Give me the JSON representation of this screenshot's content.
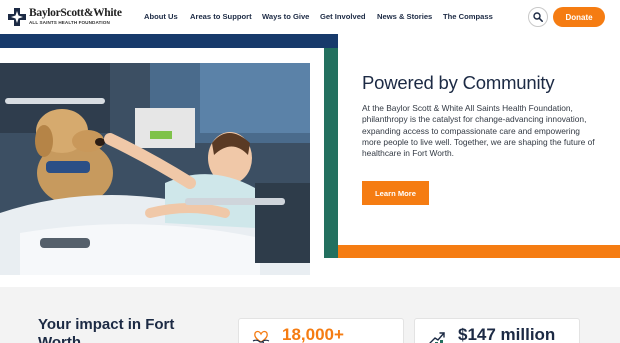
{
  "header": {
    "logo": {
      "name": "BaylorScott&White",
      "subtitle": "ALL SAINTS HEALTH FOUNDATION",
      "icon": "cross-logo-icon"
    },
    "nav": [
      {
        "label": "About Us"
      },
      {
        "label": "Areas to Support"
      },
      {
        "label": "Ways to Give"
      },
      {
        "label": "Get Involved"
      },
      {
        "label": "News & Stories"
      },
      {
        "label": "The Compass"
      }
    ],
    "search_icon": "search-icon",
    "donate_label": "Donate"
  },
  "hero": {
    "title": "Powered by Community",
    "body": "At the Baylor Scott & White All Saints Health Foundation, philanthropy is the catalyst for change-advancing innovation, expanding access to compassionate care and empowering more people to live well. Together, we are shaping the future of healthcare in Fort Worth.",
    "cta_label": "Learn More",
    "photo_subject": "patient in hospital bed petting a therapy dog"
  },
  "impact": {
    "title": "Your impact in Fort Worth",
    "stats": [
      {
        "value": "18,000+",
        "icon": "heart-hands-icon"
      },
      {
        "value": "$147 million",
        "icon": "growth-chart-icon"
      }
    ]
  },
  "colors": {
    "orange": "#f57c12",
    "navy": "#173a6b",
    "green": "#23705f",
    "text_dark": "#1c2a44"
  }
}
